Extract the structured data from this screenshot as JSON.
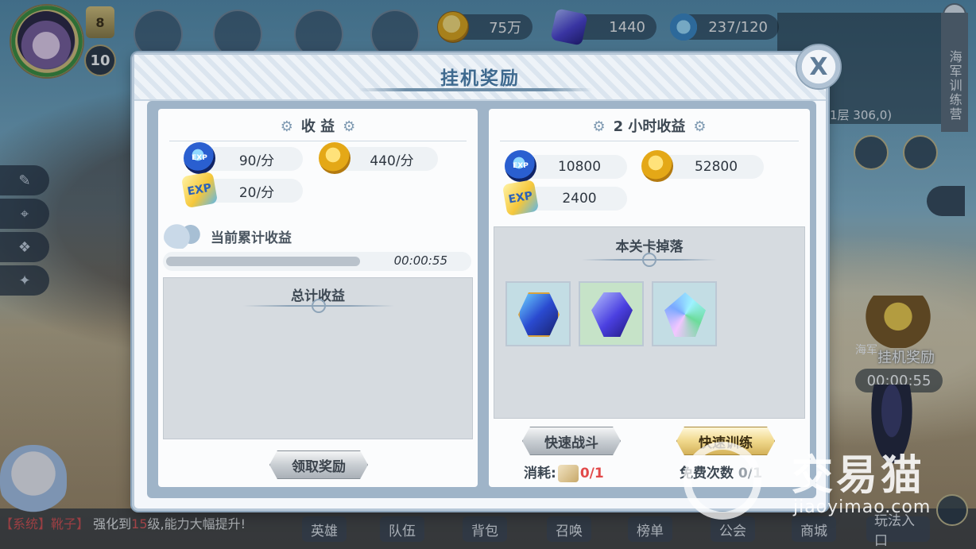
{
  "hud": {
    "level": "10",
    "vip": "8",
    "coins": "75万",
    "gems": "1440",
    "stamina": "237/120",
    "right_tab_label": "海军训练营",
    "coords": "1层  306,0)"
  },
  "afk_entry": {
    "label": "挂机奖励",
    "partial_label": "海军",
    "timer": "00:00:55"
  },
  "chat": {
    "channel": "【系统】",
    "speaker": "靴子】",
    "msg_a": "强化到",
    "msg_level": "15",
    "msg_b": "级,能力大幅提升!"
  },
  "bottom_nav": [
    "英雄",
    "队伍",
    "背包",
    "召唤",
    "榜单",
    "公会",
    "商城",
    "玩法入口"
  ],
  "watermark": {
    "text": "交易猫",
    "url": "jiaoyimao.com"
  },
  "modal": {
    "title": "挂机奖励",
    "close_icon": "X",
    "left": {
      "income_title": "收 益",
      "rates": [
        {
          "icon": "exp-blue-icon",
          "value": "90/分"
        },
        {
          "icon": "gold-coin-icon",
          "value": "440/分"
        },
        {
          "icon": "exp-yellow-icon",
          "value": "20/分"
        }
      ],
      "accum_label": "当前累计收益",
      "progress_time": "00:00:55",
      "progress_fraction": 0.0,
      "total_title": "总计收益",
      "claim_button": "领取奖励"
    },
    "right": {
      "title": "2 小时收益",
      "rewards": [
        {
          "icon": "exp-blue-icon",
          "value": "10800"
        },
        {
          "icon": "gold-coin-icon",
          "value": "52800"
        },
        {
          "icon": "exp-yellow-icon",
          "value": "2400"
        }
      ],
      "drops_title": "本关卡掉落",
      "drops": [
        {
          "name": "blue-tile-item",
          "slot": "teal"
        },
        {
          "name": "blue-gem-item",
          "slot": "green"
        },
        {
          "name": "crystal-item",
          "slot": "teal"
        }
      ],
      "quick_battle_button": "快速战斗",
      "quick_train_button": "快速训练",
      "cost_label": "消耗:",
      "cost_value": "0/1",
      "free_label": "免费次数",
      "free_value": "0/1"
    }
  },
  "icon_labels": {
    "exp_blue": "EXP",
    "exp_yellow": "EXP"
  },
  "colors": {
    "title_blue": "#3f6a8f",
    "cost_red": "#e24a4a",
    "gold_button": "#f0d88c"
  }
}
